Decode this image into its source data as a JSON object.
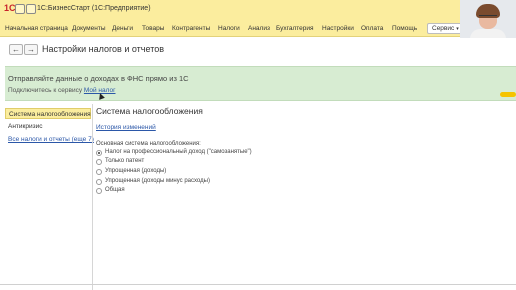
{
  "titlebar": {
    "logo": "1С",
    "app_title": "1С:БизнесСтарт  (1С:Предприятие)"
  },
  "menu": {
    "items": [
      "Начальная страница",
      "Документы",
      "Деньги",
      "Товары",
      "Контрагенты",
      "Налоги",
      "Анализ",
      "Бухгалтерия",
      "Настройки",
      "Оплата",
      "Помощь"
    ],
    "service_label": "Сервис",
    "service_arrow": "▾"
  },
  "nav": {
    "back": "←",
    "forward": "→",
    "page_title": "Настройки налогов и отчетов"
  },
  "banner": {
    "title": "Отправляйте данные о доходах в ФНС прямо из 1С",
    "sub_prefix": "Подключитесь к сервису",
    "link": "Мой налог",
    "bg_color": "#d7ecd2"
  },
  "sidebar": {
    "items": [
      "Система налогообложения",
      "Антикризис"
    ],
    "link": "Все налоги и отчеты (еще 7)"
  },
  "content": {
    "section_title": "Система налогообложения",
    "history_link": "История изменений",
    "group_label": "Основная система налогообложения:",
    "options": [
      {
        "label": "Налог на профессиональный доход (\"самозанятые\")",
        "checked": true
      },
      {
        "label": "Только патент",
        "checked": false
      },
      {
        "label": "Упрощенная (доходы)",
        "checked": false
      },
      {
        "label": "Упрощенная (доходы минус расходы)",
        "checked": false
      },
      {
        "label": "Общая",
        "checked": false
      }
    ]
  },
  "colors": {
    "accent_yellow": "#fbed9e",
    "link": "#2b57a8"
  }
}
